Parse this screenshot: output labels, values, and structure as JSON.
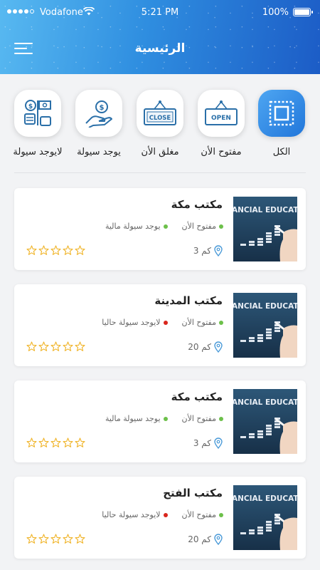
{
  "status_bar": {
    "carrier": "Vodafone",
    "time": "5:21 PM",
    "battery": "100%"
  },
  "header": {
    "title": "الرئيسية"
  },
  "filters": [
    {
      "key": "all",
      "label": "الكل",
      "active": true,
      "icon": "select-all-icon"
    },
    {
      "key": "open",
      "label": "مفتوح الأن",
      "active": false,
      "icon": "open-sign-icon",
      "sign_text": "OPEN"
    },
    {
      "key": "closed",
      "label": "مغلق الأن",
      "active": false,
      "icon": "close-sign-icon",
      "sign_text": "CLOSE"
    },
    {
      "key": "cash",
      "label": "يوجد سيولة",
      "active": false,
      "icon": "hand-money-icon"
    },
    {
      "key": "nocash",
      "label": "لايوجد سيولة",
      "active": false,
      "icon": "money-exchange-icon"
    }
  ],
  "thumbnail_text": "ANCIAL EDUCAT",
  "offices": [
    {
      "name": "مكتب مكة",
      "open_status": "مفتوح الأن",
      "cash_status": "يوجد سيولة مالية",
      "cash_available": true,
      "distance": "3 كم",
      "rating": 0
    },
    {
      "name": "مكتب المدينة",
      "open_status": "مفتوح الأن",
      "cash_status": "لايوجد سيولة حاليا",
      "cash_available": false,
      "distance": "20 كم",
      "rating": 0
    },
    {
      "name": "مكتب مكة",
      "open_status": "مفتوح الأن",
      "cash_status": "يوجد سيولة مالية",
      "cash_available": true,
      "distance": "3 كم",
      "rating": 0
    },
    {
      "name": "مكتب الفتح",
      "open_status": "مفتوح الأن",
      "cash_status": "لايوجد سيولة حاليا",
      "cash_available": false,
      "distance": "20 كم",
      "rating": 0
    }
  ],
  "colors": {
    "open_dot": "#6cc04a",
    "cash_dot": "#6cc04a",
    "no_cash_dot": "#d9261c",
    "accent": "#2b86e2",
    "star": "#f0b429",
    "icon_blue": "#2a6fa8"
  }
}
